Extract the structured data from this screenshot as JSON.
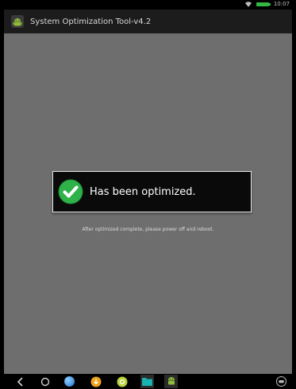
{
  "status_bar": {
    "time": "10:07",
    "battery_color": "#33b843",
    "icons": [
      "wifi-icon",
      "battery-icon"
    ]
  },
  "app": {
    "title": "System Optimization Tool-v4.2",
    "icon": "android-icon"
  },
  "toast": {
    "message": "Has been optimized.",
    "icon": "check-circle-icon",
    "accent": "#2fb24a"
  },
  "hint_text": "After optimized complete, please power off and reboot.",
  "navbar": {
    "items": [
      "back-icon",
      "home-icon",
      "browser-icon",
      "download-icon",
      "app-store-icon",
      "folder-icon",
      "android-app-icon"
    ],
    "right_icon": "game-controller-icon"
  }
}
